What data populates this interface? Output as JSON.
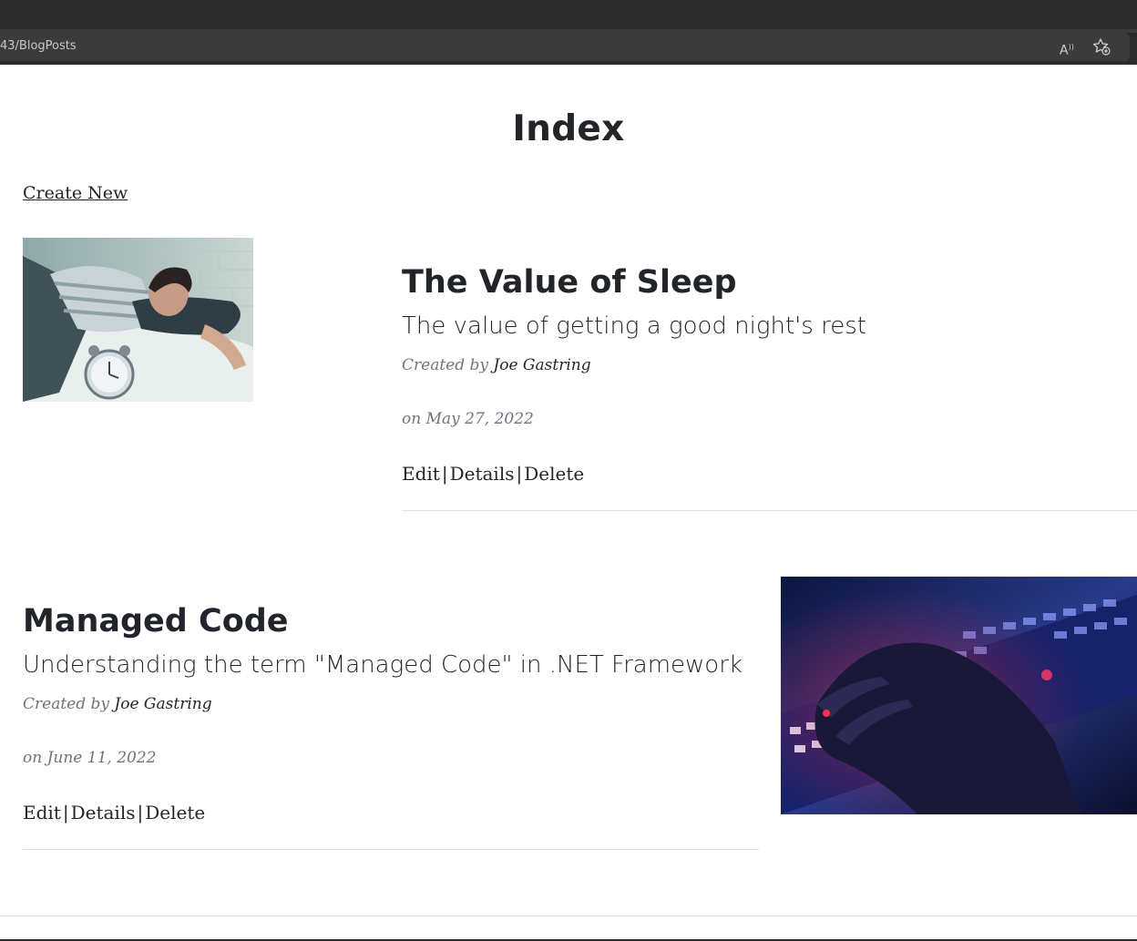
{
  "browser": {
    "url": "43/BlogPosts",
    "read_aloud_icon": "read-aloud-icon",
    "favorite_icon": "add-favorite-icon"
  },
  "page": {
    "title": "Index",
    "create_link": "Create New"
  },
  "posts": [
    {
      "title": "The Value of Sleep",
      "subtitle": "The value of getting a good night's rest",
      "created_by_label": "Created by",
      "author": "Joe Gastring",
      "date": "on May 27, 2022",
      "actions": [
        "Edit",
        "Details",
        "Delete"
      ],
      "image": "woman-in-bed-with-alarm-clock"
    },
    {
      "title": "Managed Code",
      "subtitle": "Understanding the term \"Managed Code\" in .NET Framework",
      "created_by_label": "Created by",
      "author": "Joe Gastring",
      "date": "on June 11, 2022",
      "actions": [
        "Edit",
        "Details",
        "Delete"
      ],
      "image": "hand-on-backlit-keyboard"
    }
  ],
  "colors": {
    "text": "#212529",
    "muted": "#6c757d",
    "chrome": "#2b2b2b",
    "rule": "#dee2e6"
  }
}
